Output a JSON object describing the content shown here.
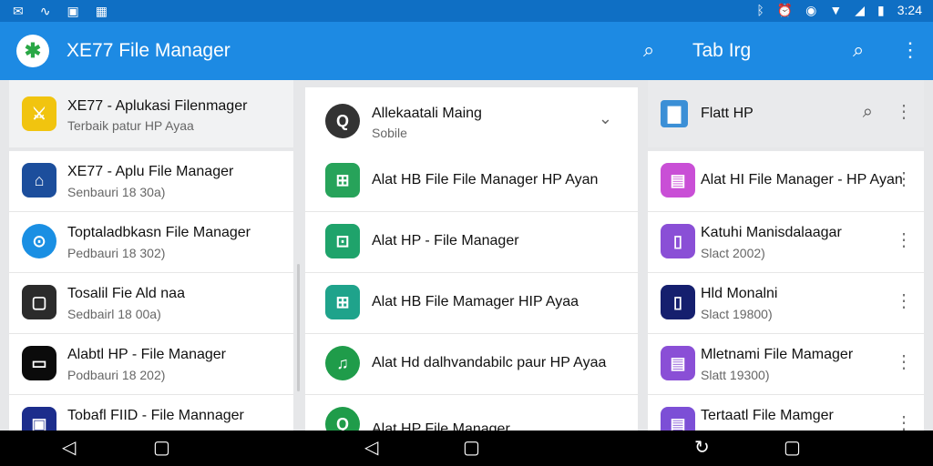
{
  "status_bar": {
    "time": "3:24",
    "left_icons": [
      "mail-icon",
      "gesture-icon",
      "photo-icon",
      "calendar-icon"
    ],
    "right_icons": [
      "bluetooth-icon",
      "alarm-icon",
      "hotspot-icon",
      "wifi-icon",
      "signal-icon",
      "battery-icon"
    ]
  },
  "app_bar": {
    "title": "XE77 File Manager",
    "tab_label": "Tab Irg",
    "color": "#1d8ae3"
  },
  "panel1": {
    "header": {
      "title": "XE77 - Aplukasi Filenmager",
      "subtitle": "Terbaik patur HP Ayaa",
      "icon_color": "#f1c40f"
    },
    "rows": [
      {
        "title": "XE77 - Aplu File Manager",
        "subtitle": "Senbauri 18 30a)",
        "icon_color": "#1c4e9c"
      },
      {
        "title": "Toptaladbkasn File Manager",
        "subtitle": "Pedbauri 18 302)",
        "icon_color": "#1a8fe3"
      },
      {
        "title": "Tosalil Fie Ald naa",
        "subtitle": "Sedbairl 18 00a)",
        "icon_color": "#2b2b2b"
      },
      {
        "title": "Alabtl HP - File Manager",
        "subtitle": "Podbauri 18 202)",
        "icon_color": "#0b0b0b"
      },
      {
        "title": "Tobafl FIID - File Mannager",
        "subtitle": "",
        "icon_color": "#1c2d8c"
      }
    ]
  },
  "panel2": {
    "header": {
      "title": "Allekaatali Maing",
      "subtitle": "Sobile",
      "icon_color": "#333333"
    },
    "rows": [
      {
        "title": "Alat HB File File Manager HP Ayan",
        "icon_color": "#27a35a"
      },
      {
        "title": "Alat HP - File Manager",
        "icon_color": "#1fa36b"
      },
      {
        "title": "Alat HB File Mamager HIP Ayaa",
        "icon_color": "#1fa38b"
      },
      {
        "title": "Alat Hd dalhvandabilc paur HP Ayaa",
        "icon_color": "#1f9c4a"
      },
      {
        "title": "Alat HP File Manager",
        "icon_color": "#1f9c4a"
      }
    ]
  },
  "panel3": {
    "header": {
      "title": "Flatt HP",
      "icon_color": "#3b8fd6"
    },
    "rows": [
      {
        "title": "Alat HI File Manager - HP Ayan",
        "subtitle": "",
        "icon_color": "#c94fd6"
      },
      {
        "title": "Katuhi Manisdalaagar",
        "subtitle": "Slact 2002)",
        "icon_color": "#8a4fd6"
      },
      {
        "title": "Hld Monalni",
        "subtitle": "Slact 19800)",
        "icon_color": "#151f6e"
      },
      {
        "title": "Mletnami File Mamager",
        "subtitle": "Slatt 19300)",
        "icon_color": "#8a4fd6"
      },
      {
        "title": "Tertaatl File Mamger",
        "subtitle": "",
        "icon_color": "#7c4fd6"
      }
    ]
  },
  "nav_bar": {
    "buttons": [
      "back-icon",
      "home-icon",
      "back-icon",
      "home-icon",
      "recent-icon",
      "overview-icon"
    ]
  }
}
